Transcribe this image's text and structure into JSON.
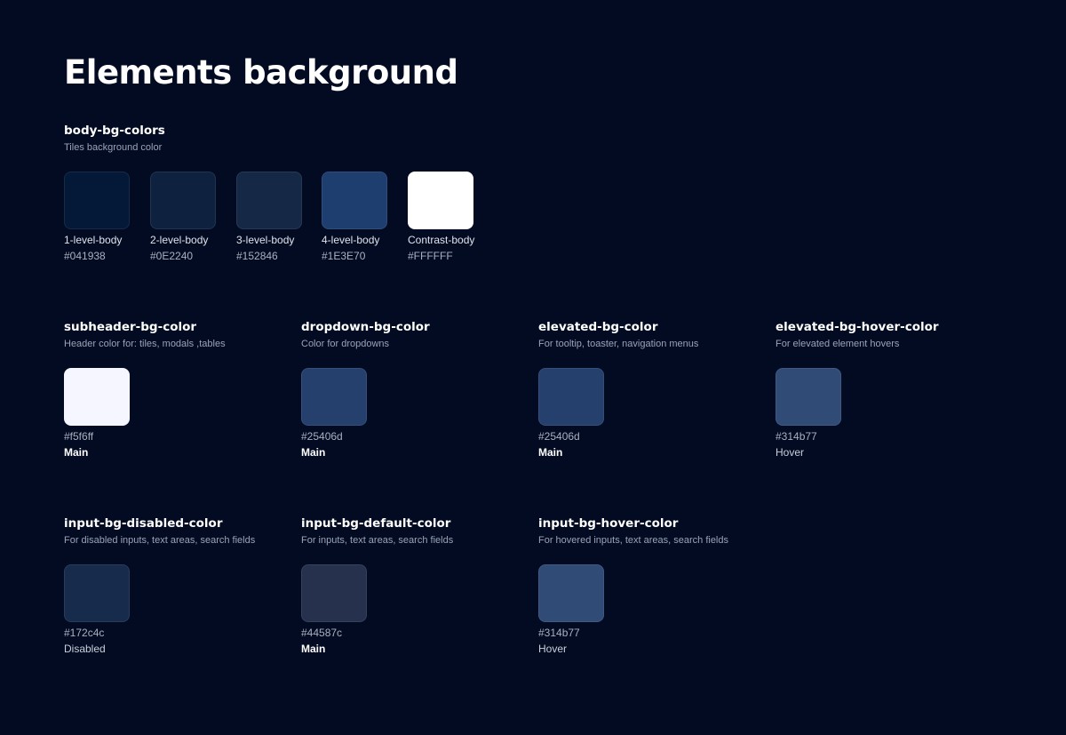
{
  "title": "Elements background",
  "body_section": {
    "title": "body-bg-colors",
    "description": "Tiles background color",
    "swatches": [
      {
        "name": "1-level-body",
        "hex": "#041938",
        "color": "#041938"
      },
      {
        "name": "2-level-body",
        "hex": "#0E2240",
        "color": "#0E2240"
      },
      {
        "name": "3-level-body",
        "hex": "#152846",
        "color": "#152846"
      },
      {
        "name": "4-level-body",
        "hex": "#1E3E70",
        "color": "#1E3E70"
      },
      {
        "name": "Contrast-body",
        "hex": "#FFFFFF",
        "color": "#FFFFFF"
      }
    ]
  },
  "sections": [
    {
      "key": "subheader",
      "title": "subheader-bg-color",
      "description": "Header color for: tiles, modals ,tables",
      "swatch": {
        "hex": "#f5f6ff",
        "color": "#f5f6ff",
        "state": "Main"
      }
    },
    {
      "key": "dropdown",
      "title": "dropdown-bg-color",
      "description": "Color for dropdowns",
      "swatch": {
        "hex": "#25406d",
        "color": "#25406d",
        "state": "Main"
      }
    },
    {
      "key": "elevated",
      "title": "elevated-bg-color",
      "description": "For tooltip, toaster, navigation menus",
      "swatch": {
        "hex": "#25406d",
        "color": "#25406d",
        "state": "Main"
      }
    },
    {
      "key": "elevated-hover",
      "title": "elevated-bg-hover-color",
      "description": "For elevated element hovers",
      "swatch": {
        "hex": "#314b77",
        "color": "#314b77",
        "state": "Hover"
      }
    },
    {
      "key": "input-disabled",
      "title": "input-bg-disabled-color",
      "description": "For disabled inputs, text areas, search fields",
      "swatch": {
        "hex": "#172c4c",
        "color": "#172c4c",
        "state": "Disabled"
      }
    },
    {
      "key": "input-default",
      "title": "input-bg-default-color",
      "description": "For inputs, text areas, search fields",
      "swatch": {
        "hex": "#44587c",
        "color": "#26314d",
        "state": "Main"
      }
    },
    {
      "key": "input-hover",
      "title": "input-bg-hover-color",
      "description": "For hovered inputs, text areas, search fields",
      "swatch": {
        "hex": "#314b77",
        "color": "#314b77",
        "state": "Hover"
      }
    }
  ]
}
